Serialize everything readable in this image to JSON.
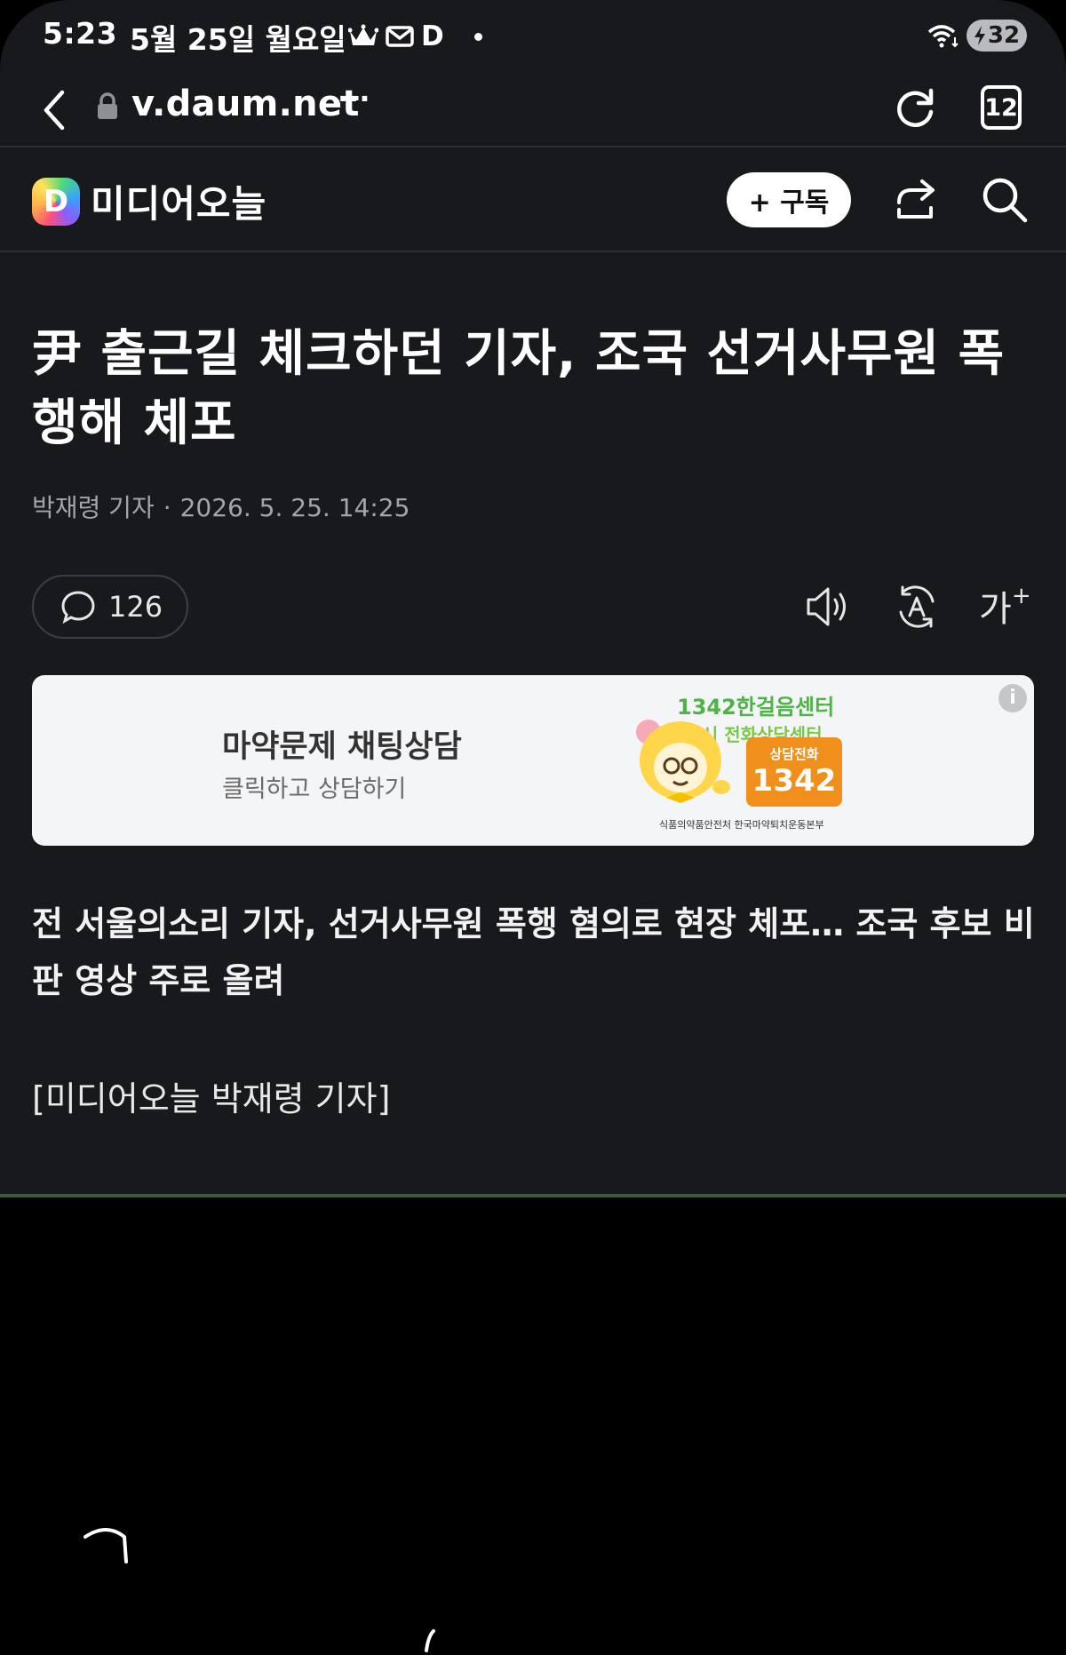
{
  "status_bar": {
    "time": "5:23",
    "date": "5월 25일 월요일",
    "app_badge": "D",
    "battery": "32"
  },
  "browser": {
    "url": "v.daum.net",
    "more": "···",
    "tab_count": "12"
  },
  "site": {
    "logo_letter": "D",
    "media_name": "미디어오늘",
    "subscribe_label": "+ 구독"
  },
  "article": {
    "headline": "尹 출근길 체크하던 기자, 조국 선거사무원 폭행해 체포",
    "author": "박재령 기자",
    "datetime": "2026. 5. 25. 14:25",
    "comment_count": "126",
    "font_tool": "가",
    "font_tool_plus": "+",
    "summary": "전 서울의소리 기자, 선거사무원 폭행 혐의로 현장 체포… 조국 후보 비판 영상 주로 올려",
    "reporter_line": "[미디어오늘 박재령 기자]"
  },
  "ad": {
    "title": "마약문제 채팅상담",
    "subtitle": "클릭하고 상담하기",
    "info_icon": "i",
    "brand": "1342한걸음센터",
    "brand_sub": "24시 전화상담센터",
    "call_label": "상담전화",
    "call_number": "1342",
    "sponsor": "식품의약품안전처   한국마약퇴치운동본부"
  },
  "colors": {
    "background": "#18191d",
    "divider": "#2d2e33",
    "ad_orange": "#f18f1c",
    "ad_green": "#4fb348"
  }
}
